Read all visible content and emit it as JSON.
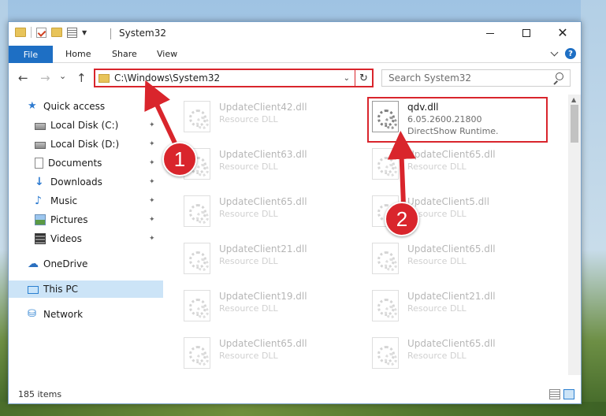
{
  "window": {
    "title": "System32",
    "minimize_glyph": "",
    "close_glyph": "✕"
  },
  "ribbon": {
    "tabs": [
      "File",
      "Home",
      "Share",
      "View"
    ],
    "help": "?"
  },
  "nav": {
    "back": "←",
    "forward": "→",
    "recent": "⌄",
    "up": "↑"
  },
  "address": {
    "path": "C:\\Windows\\System32",
    "dropdown": "⌄",
    "refresh": "↻"
  },
  "search": {
    "placeholder": "Search System32"
  },
  "sidebar": {
    "items": [
      {
        "label": "Quick access",
        "icon": "star-icon",
        "pinned": false
      },
      {
        "label": "Local Disk (C:)",
        "icon": "drive-icon",
        "pinned": true
      },
      {
        "label": "Local Disk (D:)",
        "icon": "drive-icon",
        "pinned": true
      },
      {
        "label": "Documents",
        "icon": "document-icon",
        "pinned": true
      },
      {
        "label": "Downloads",
        "icon": "download-icon",
        "pinned": true
      },
      {
        "label": "Music",
        "icon": "music-icon",
        "pinned": true
      },
      {
        "label": "Pictures",
        "icon": "pictures-icon",
        "pinned": true
      },
      {
        "label": "Videos",
        "icon": "video-icon",
        "pinned": true
      },
      {
        "label": "OneDrive",
        "icon": "cloud-icon",
        "pinned": false
      },
      {
        "label": "This PC",
        "icon": "computer-icon",
        "pinned": false,
        "selected": true
      },
      {
        "label": "Network",
        "icon": "network-icon",
        "pinned": false
      }
    ],
    "pin_glyph": "📌"
  },
  "files": [
    {
      "name": "UpdateClient42.dll",
      "meta1": "Resource DLL",
      "meta2": "",
      "faded": true
    },
    {
      "name": "qdv.dll",
      "meta1": "6.05.2600.21800",
      "meta2": "DirectShow Runtime.",
      "faded": false
    },
    {
      "name": "UpdateClient63.dll",
      "meta1": "Resource DLL",
      "meta2": "",
      "faded": true
    },
    {
      "name": "UpdateClient65.dll",
      "meta1": "Resource DLL",
      "meta2": "",
      "faded": true
    },
    {
      "name": "UpdateClient65.dll",
      "meta1": "Resource DLL",
      "meta2": "",
      "faded": true
    },
    {
      "name": "UpdateClient5.dll",
      "meta1": "Resource DLL",
      "meta2": "",
      "faded": true
    },
    {
      "name": "UpdateClient21.dll",
      "meta1": "Resource DLL",
      "meta2": "",
      "faded": true
    },
    {
      "name": "UpdateClient65.dll",
      "meta1": "Resource DLL",
      "meta2": "",
      "faded": true
    },
    {
      "name": "UpdateClient19.dll",
      "meta1": "Resource DLL",
      "meta2": "",
      "faded": true
    },
    {
      "name": "UpdateClient21.dll",
      "meta1": "Resource DLL",
      "meta2": "",
      "faded": true
    },
    {
      "name": "UpdateClient65.dll",
      "meta1": "Resource DLL",
      "meta2": "",
      "faded": true
    },
    {
      "name": "UpdateClient65.dll",
      "meta1": "Resource DLL",
      "meta2": "",
      "faded": true
    }
  ],
  "status": {
    "items_count": "185 items"
  },
  "callouts": {
    "step1": "1",
    "step2": "2",
    "accent_color": "#d9252c"
  }
}
